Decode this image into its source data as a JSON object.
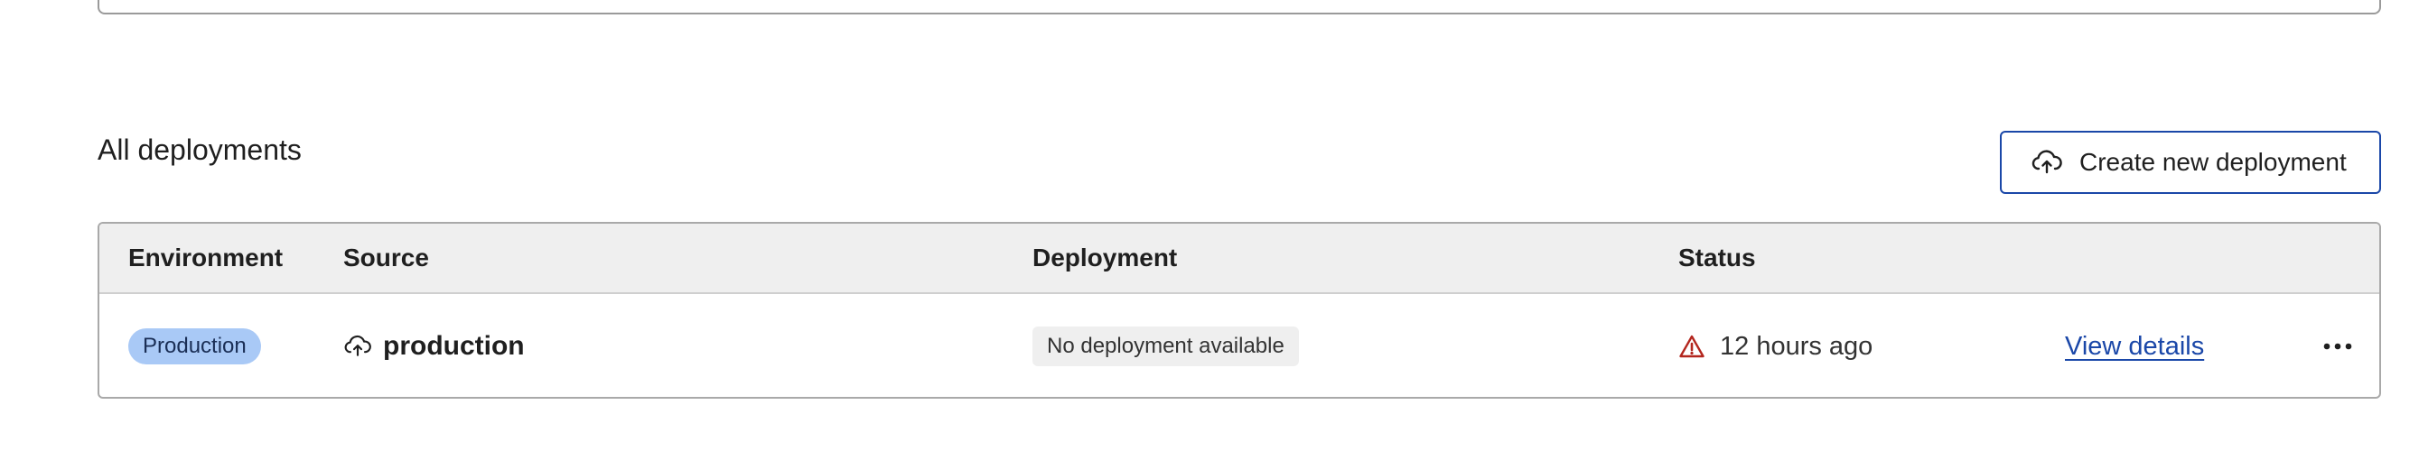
{
  "section": {
    "title": "All deployments",
    "create_button_label": "Create new deployment",
    "create_button_icon": "cloud-upload-icon"
  },
  "table": {
    "columns": [
      "Environment",
      "Source",
      "Deployment",
      "Status"
    ],
    "rows": [
      {
        "environment": "Production",
        "source_icon": "cloud-upload-icon",
        "source": "production",
        "deployment": "No deployment available",
        "status_icon": "warning-triangle-icon",
        "status": "12 hours ago",
        "action_label": "View details",
        "more_icon": "more-horizontal-icon"
      }
    ]
  },
  "colors": {
    "accent": "#1a47a8",
    "badge_env_bg": "#a9c9f6",
    "warning": "#b3261e",
    "header_bg": "#efefef"
  }
}
